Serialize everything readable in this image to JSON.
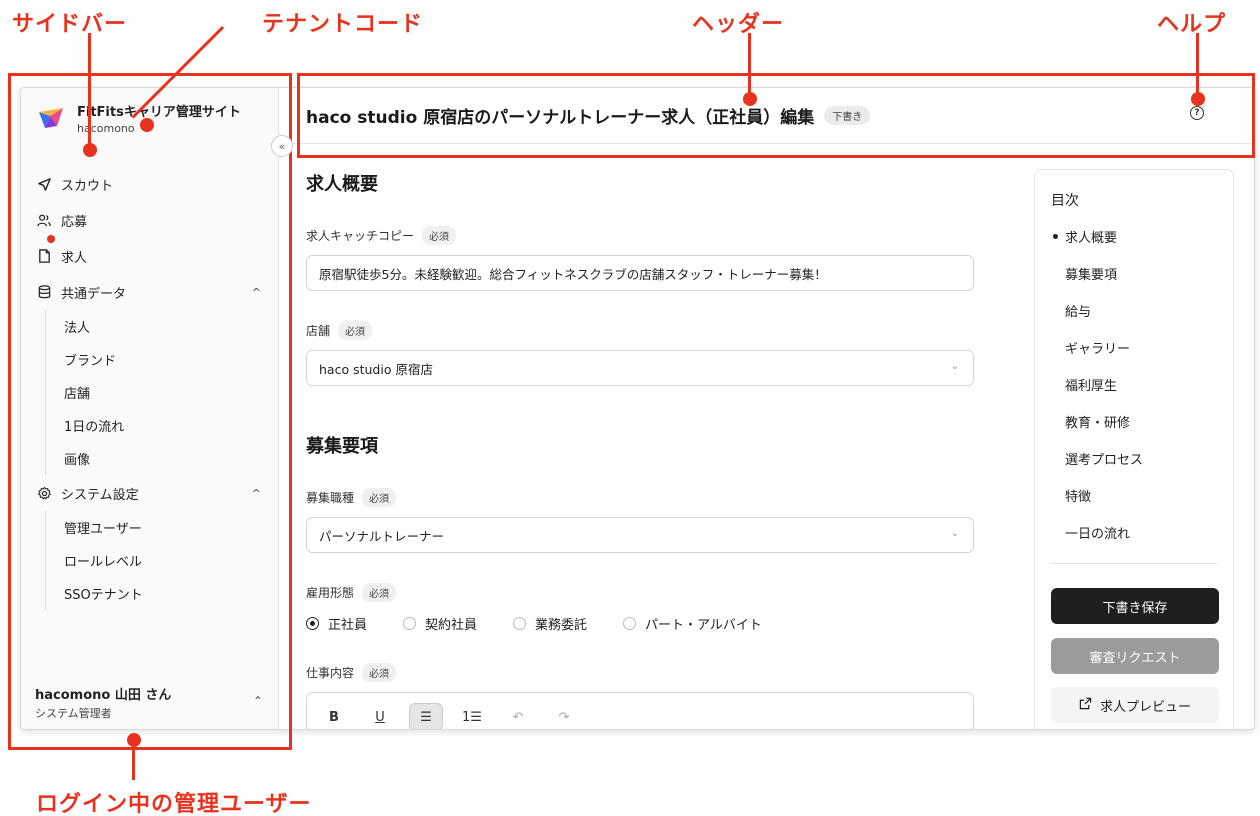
{
  "annotations": {
    "sidebar": "サイドバー",
    "tenant_code": "テナントコード",
    "header": "ヘッダー",
    "help": "ヘルプ",
    "login_user": "ログイン中の管理ユーザー"
  },
  "colors": {
    "annotation": "#e8321e",
    "primary_button": "#1f1f1f",
    "disabled_button": "#9b9b9b"
  },
  "sidebar": {
    "tenant_name": "FitFitsキャリア管理サイト",
    "tenant_code": "hacomono",
    "collapse_icon": "«",
    "items": [
      {
        "label": "スカウト",
        "icon": "paper-plane-icon"
      },
      {
        "label": "応募",
        "icon": "users-icon"
      },
      {
        "label": "求人",
        "icon": "document-icon"
      },
      {
        "label": "共通データ",
        "icon": "database-icon"
      }
    ],
    "common_data_children": [
      "法人",
      "ブランド",
      "店舗",
      "1日の流れ",
      "画像"
    ],
    "system_settings": {
      "label": "システム設定",
      "icon": "gear-icon"
    },
    "system_children": [
      "管理ユーザー",
      "ロールレベル",
      "SSOテナント"
    ],
    "user": {
      "name": "hacomono 山田 さん",
      "role": "システム管理者"
    }
  },
  "header": {
    "title": "haco studio 原宿店のパーソナルトレーナー求人（正社員）編集",
    "badge": "下書き",
    "help_icon": "?"
  },
  "form": {
    "section1": "求人概要",
    "catch_label": "求人キャッチコピー",
    "required": "必須",
    "catch_value": "原宿駅徒歩5分。未経験歓迎。総合フィットネスクラブの店舗スタッフ・トレーナー募集！",
    "store_label": "店舗",
    "store_value": "haco studio 原宿店",
    "section2": "募集要項",
    "job_label": "募集職種",
    "job_value": "パーソナルトレーナー",
    "employment_label": "雇用形態",
    "employment_options": [
      "正社員",
      "契約社員",
      "業務委託",
      "パート・アルバイト"
    ],
    "employment_selected": "正社員",
    "work_label": "仕事内容",
    "toolbar": {
      "bold": "B",
      "underline": "U",
      "bullet": "☰",
      "ordered": "1☰",
      "undo": "↶",
      "redo": "↷"
    }
  },
  "toc": {
    "title": "目次",
    "items": [
      "求人概要",
      "募集要項",
      "給与",
      "ギャラリー",
      "福利厚生",
      "教育・研修",
      "選考プロセス",
      "特徴",
      "一日の流れ"
    ],
    "active": "求人概要",
    "save_button": "下書き保存",
    "review_button": "審査リクエスト",
    "preview_button": "求人プレビュー"
  }
}
